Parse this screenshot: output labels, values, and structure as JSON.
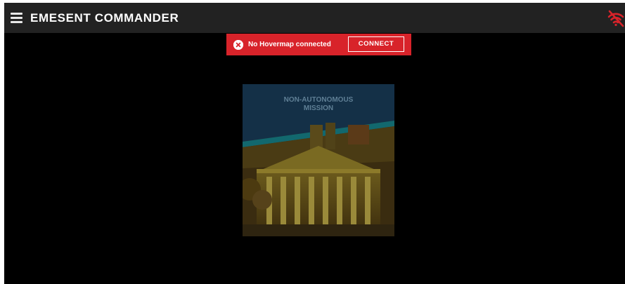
{
  "header": {
    "title": "EMESENT COMMANDER",
    "menu_icon": "hamburger-menu-icon",
    "connection_icon": "wifi-off-icon"
  },
  "banner": {
    "icon": "error-icon",
    "message": "No Hovermap connected",
    "connect_label": "CONNECT"
  },
  "mission_card": {
    "title_line1": "NON-AUTONOMOUS",
    "title_line2": "MISSION"
  },
  "colors": {
    "topbar": "#222222",
    "background": "#000000",
    "banner_red": "#d8232a",
    "wifi_off_red": "#d8232a",
    "card_blue": "#143047",
    "card_teal": "#12686e"
  }
}
